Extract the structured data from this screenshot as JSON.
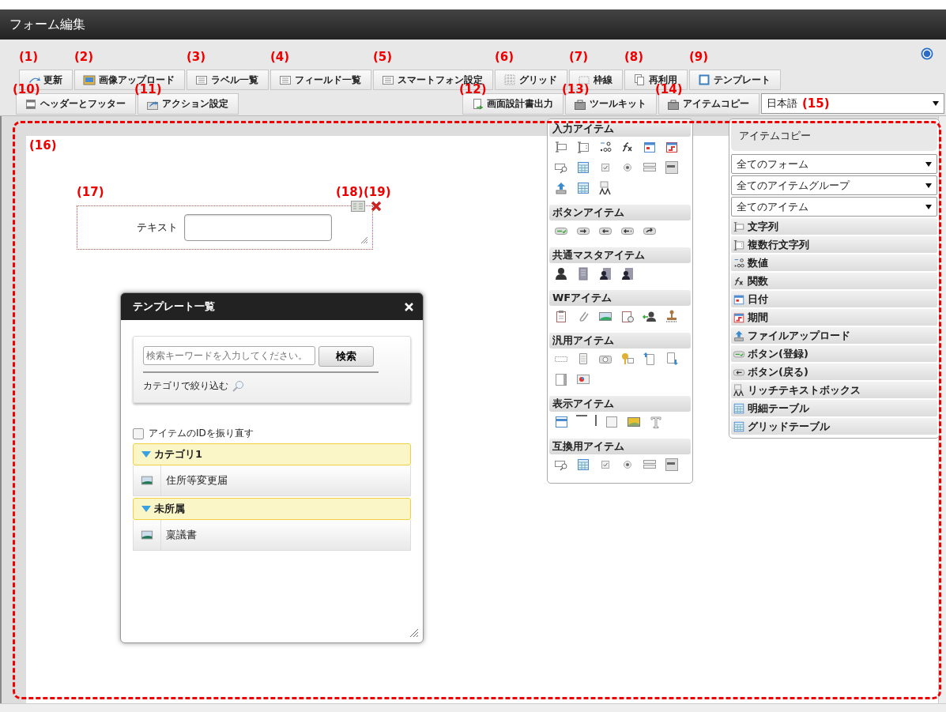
{
  "window": {
    "title": "フォーム編集"
  },
  "toolbar": {
    "top_row": [
      {
        "label": "更新",
        "callout": "(1)"
      },
      {
        "label": "画像アップロード",
        "callout": "(2)"
      },
      {
        "label": "ラベル一覧",
        "callout": "(3)"
      },
      {
        "label": "フィールド一覧",
        "callout": "(4)"
      },
      {
        "label": "スマートフォン設定",
        "callout": "(5)"
      },
      {
        "label": "グリッド",
        "callout": "(6)"
      },
      {
        "label": "枠線",
        "callout": "(7)"
      },
      {
        "label": "再利用",
        "callout": "(8)"
      },
      {
        "label": "テンプレート",
        "callout": "(9)"
      }
    ],
    "bottom_left": [
      {
        "label": "ヘッダーとフッター",
        "callout": "(10)"
      },
      {
        "label": "アクション設定",
        "callout": "(11)"
      }
    ],
    "bottom_right": [
      {
        "label": "画面設計書出力",
        "callout": "(12)"
      },
      {
        "label": "ツールキット",
        "callout": "(13)"
      },
      {
        "label": "アイテムコピー",
        "callout": "(14)"
      }
    ],
    "language_select": {
      "value": "日本語",
      "callout": "(15)"
    }
  },
  "canvas": {
    "callout": "(16)",
    "form_item": {
      "callout": "(17)",
      "label": "テキスト",
      "settings_callout": "(18)",
      "delete_callout": "(19)"
    }
  },
  "toolkit": {
    "sections": [
      {
        "title": "入力アイテム"
      },
      {
        "title": "ボタンアイテム"
      },
      {
        "title": "共通マスタアイテム"
      },
      {
        "title": "WFアイテム"
      },
      {
        "title": "汎用アイテム"
      },
      {
        "title": "表示アイテム"
      },
      {
        "title": "互換用アイテム"
      }
    ]
  },
  "item_copy": {
    "title": "アイテムコピー",
    "filters": [
      {
        "value": "全てのフォーム"
      },
      {
        "value": "全てのアイテムグループ"
      },
      {
        "value": "全てのアイテム"
      }
    ],
    "items": [
      {
        "label": "文字列"
      },
      {
        "label": "複数行文字列"
      },
      {
        "label": "数値"
      },
      {
        "label": "関数"
      },
      {
        "label": "日付"
      },
      {
        "label": "期間"
      },
      {
        "label": "ファイルアップロード"
      },
      {
        "label": "ボタン(登録)"
      },
      {
        "label": "ボタン(戻る)"
      },
      {
        "label": "リッチテキストボックス"
      },
      {
        "label": "明細テーブル"
      },
      {
        "label": "グリッドテーブル"
      }
    ]
  },
  "template_dialog": {
    "title": "テンプレート一覧",
    "search": {
      "placeholder": "検索キーワードを入力してください。",
      "button": "検索"
    },
    "filter_link": "カテゴリで絞り込む",
    "renumber": {
      "label": "アイテムのIDを振り直す",
      "checked": false
    },
    "categories": [
      {
        "name": "カテゴリ1",
        "expanded": true,
        "templates": [
          "住所等変更届"
        ]
      },
      {
        "name": "未所属",
        "expanded": true,
        "templates": [
          "稟議書"
        ]
      }
    ]
  }
}
